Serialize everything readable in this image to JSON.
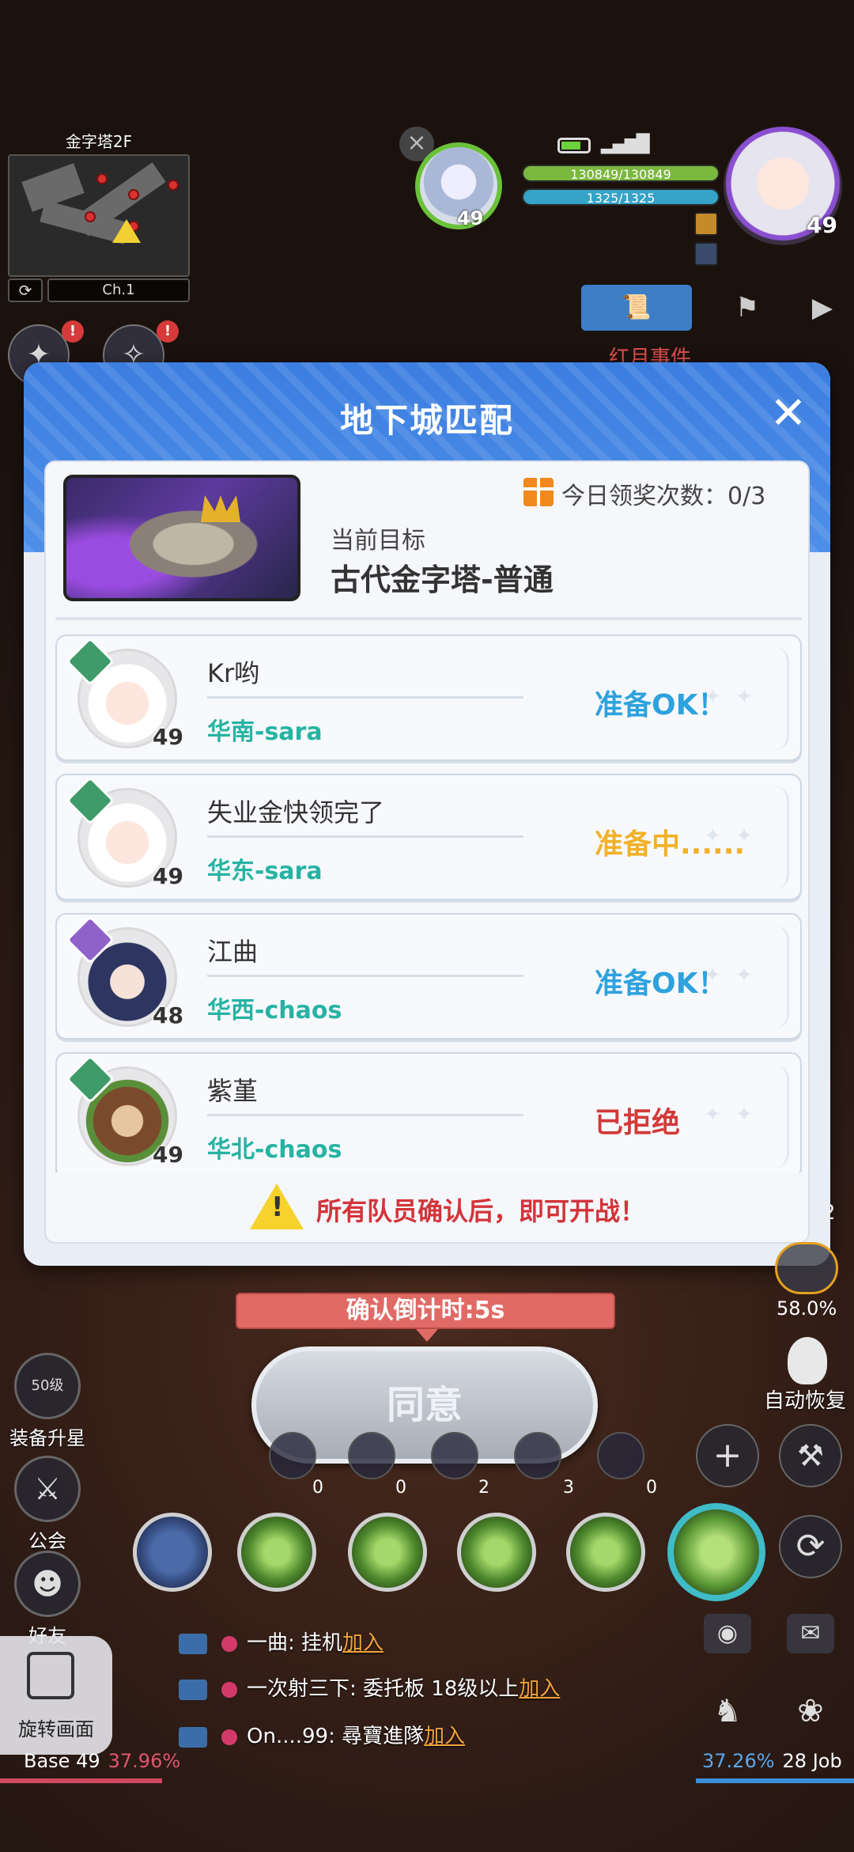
{
  "hud": {
    "map_name": "金字塔2F",
    "channel": "Ch.1",
    "pet_level": "49",
    "hp": "130849/130849",
    "sp": "1325/1325",
    "player_level": "49",
    "event_label": "红月事件",
    "weight_percent": "58.0%",
    "auto_recover_label": "自动恢复",
    "equip_upgrade_level": "50级",
    "equip_upgrade_label": "装备升星",
    "guild_label": "公会",
    "friends_label": "好友",
    "side_number": "2",
    "item_counts": [
      "0",
      "0",
      "2",
      "3",
      "0"
    ],
    "rotate_label": "旋转画面",
    "base_label": "Base",
    "base_level": "49",
    "base_percent": "37.96%",
    "job_label": "Job",
    "job_level": "28",
    "job_percent": "37.26%"
  },
  "chat": [
    {
      "text": "一曲: 挂机",
      "join": "加入"
    },
    {
      "text": "一次射三下: 委托板 18级以上",
      "join": "加入"
    },
    {
      "text": "On....99: 尋寶進隊",
      "join": "加入"
    }
  ],
  "modal": {
    "title": "地下城匹配",
    "reward_text": "今日领奖次数：0/3",
    "target_label": "当前目标",
    "target_name": "古代金字塔-普通",
    "members": [
      {
        "name": "Kr哟",
        "server": "华南-sara",
        "level": "49",
        "status": "准备OK！",
        "status_type": "ok"
      },
      {
        "name": "失业金快领完了",
        "server": "华东-sara",
        "level": "49",
        "status": "准备中......",
        "status_type": "wait"
      },
      {
        "name": "江曲",
        "server": "华西-chaos",
        "level": "48",
        "status": "准备OK！",
        "status_type": "ok"
      },
      {
        "name": "紫堇",
        "server": "华北-chaos",
        "level": "49",
        "status": "已拒绝",
        "status_type": "reject"
      }
    ],
    "warning": "所有队员确认后，即可开战！"
  },
  "countdown": "确认倒计时:5s",
  "agree_label": "同意",
  "colors": {
    "header_blue": "#3b7ee0",
    "ready_blue": "#2ea2dd",
    "waiting_orange": "#f1b129",
    "rejected_red": "#d23a3a",
    "server_teal": "#27b3a3"
  }
}
